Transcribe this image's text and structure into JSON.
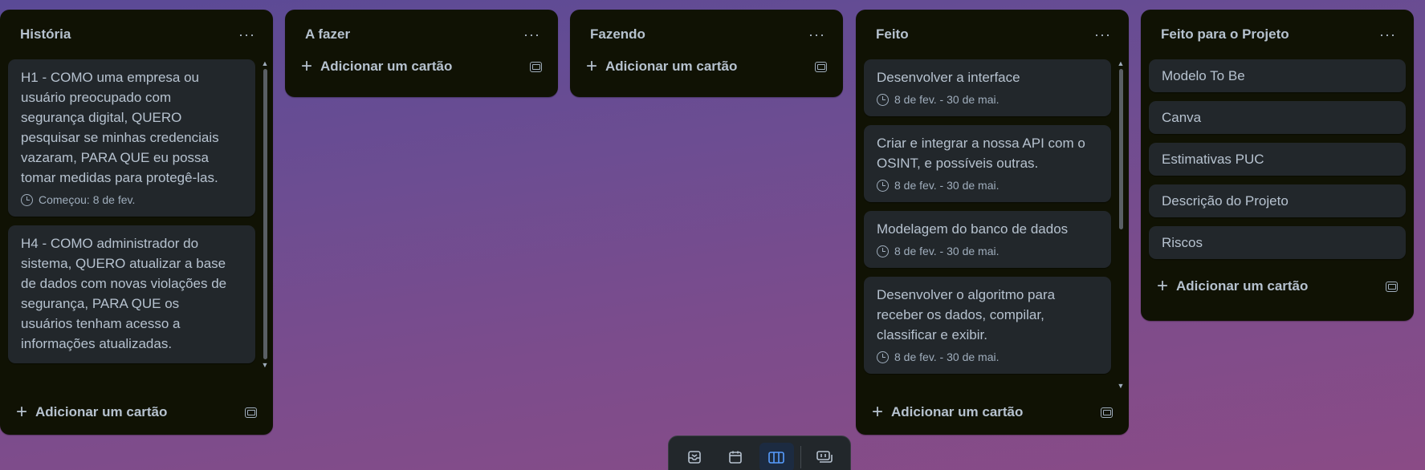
{
  "lists": [
    {
      "title": "História",
      "cards": [
        {
          "text": "H1 - COMO uma empresa ou usuário preocupado com segurança digital, QUERO pesquisar se minhas credenciais vazaram, PARA QUE eu possa tomar medidas para protegê-las.",
          "date": "Começou: 8 de fev."
        },
        {
          "text": "H4 - COMO administrador do sistema, QUERO atualizar a base de dados com novas violações de segurança, PARA QUE os usuários tenham acesso a informações atualizadas."
        }
      ],
      "add_label": "Adicionar um cartão"
    },
    {
      "title": "A fazer",
      "cards": [],
      "add_label": "Adicionar um cartão"
    },
    {
      "title": "Fazendo",
      "cards": [],
      "add_label": "Adicionar um cartão"
    },
    {
      "title": "Feito",
      "cards": [
        {
          "text": "Desenvolver a interface",
          "date": "8 de fev. - 30 de mai."
        },
        {
          "text": "Criar e integrar a nossa API com o OSINT, e possíveis outras.",
          "date": "8 de fev. - 30 de mai."
        },
        {
          "text": "Modelagem do banco de dados",
          "date": "8 de fev. - 30 de mai."
        },
        {
          "text": "Desenvolver o algoritmo para receber os dados, compilar, classificar e exibir.",
          "date": "8 de fev. - 30 de mai."
        }
      ],
      "add_label": "Adicionar um cartão"
    },
    {
      "title": "Feito para o Projeto",
      "cards": [
        {
          "text": "Modelo To Be"
        },
        {
          "text": "Canva"
        },
        {
          "text": "Estimativas PUC"
        },
        {
          "text": "Descrição do Projeto"
        },
        {
          "text": "Riscos"
        }
      ],
      "add_label": "Adicionar um cartão"
    }
  ],
  "bottom_nav": [
    "inbox-icon",
    "calendar-icon",
    "board-icon",
    "switch-boards-icon"
  ]
}
